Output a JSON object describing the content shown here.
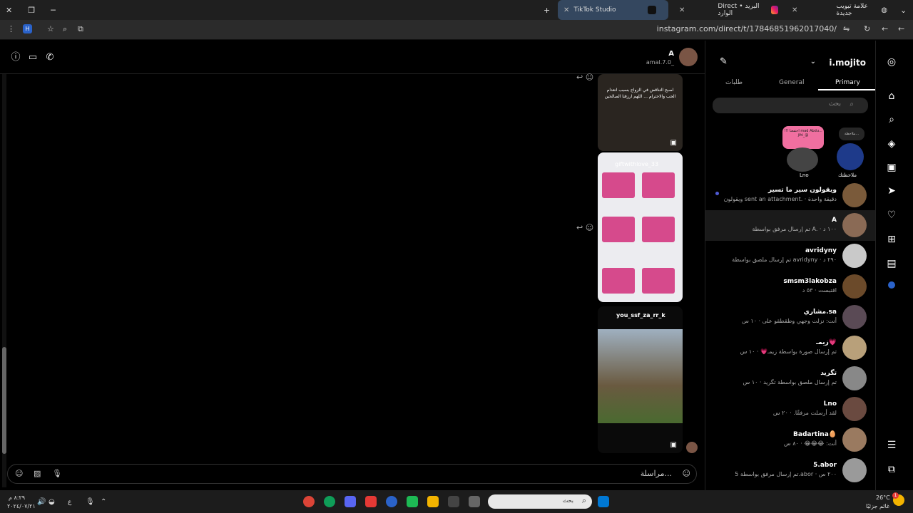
{
  "browser": {
    "tabs": [
      {
        "title": "TikTok Studio",
        "active": true
      },
      {
        "title": "Direct • البريد الوارد",
        "active": false
      },
      {
        "title": "علامة تبويب جديدة",
        "active": false
      }
    ],
    "url": "instagram.com/direct/t/17846851962017040/",
    "profile_letter": "H"
  },
  "chat": {
    "contact_name": "A",
    "contact_handle": "amal.7.0_",
    "media": [
      {
        "caption": "اصبح التناقض في الزواج بسبب انعدام الحب والاحترام ... اللهم ارزقنا الصالحين",
        "type": "reel"
      },
      {
        "sender": "giftwithlove_33",
        "type": "reel"
      },
      {
        "sender": "you_ssf_za_rr_k",
        "type": "reel"
      }
    ],
    "composer_placeholder": "مراسلة..."
  },
  "sidebar": {
    "username": "i.mojito",
    "tabs": [
      "Primary",
      "General",
      "طلبات"
    ],
    "active_tab": "Primary",
    "search_placeholder": "بحث",
    "notes": [
      {
        "label": "ملاحظتك",
        "bubble": "ملاحظة..."
      },
      {
        "label": "Lno",
        "bubble": "!!! احتفعنا mad Abdu... jihi_@"
      }
    ],
    "threads": [
      {
        "name": "ويقولون سير ما تسير",
        "msg": "ويقولون sent an attachment. · دقيقة واحدة",
        "color": "#7a5a3a"
      },
      {
        "name": "A",
        "msg": "تم إرسال مرفق بواسطة A. · ١٠٠ د",
        "color": "#8a6a55"
      },
      {
        "name": "avridyny",
        "msg": "تم إرسال ملصق بواسطة avridyny · ٢٩٠ د",
        "color": "#c9c9c9"
      },
      {
        "name": "smsm3lakobza",
        "msg": "اقتبست · ٥٣ د",
        "color": "#6b4a2a"
      },
      {
        "name": "مشاري.sa",
        "msg": "أنت: نزلت وجهي وطقطقو على · ١٠ س",
        "color": "#5a4a55"
      },
      {
        "name": "زيمـ💗",
        "msg": "تم إرسال صورة بواسطة زيمـ💗 · ١٠ س",
        "color": "#b8a07a"
      },
      {
        "name": "تگريد",
        "msg": "تم إرسال ملصق بواسطة تگريد · ١٠ س",
        "color": "#888888"
      },
      {
        "name": "Lno",
        "msg": "لقد أرسلت مرفقًا. · ٢٠ س",
        "color": "#6a4a40"
      },
      {
        "name": "Badartina🥚",
        "msg": "أنت: 😂😂😂 · ٨٠ س",
        "color": "#9a7a60"
      },
      {
        "name": "5.abor",
        "msg": "تم إرسال مرفق بواسطة 5.abor · ٢٠٠ س",
        "color": "#9a9a9a"
      }
    ]
  },
  "taskbar": {
    "weather_temp": "26°C",
    "weather_desc": "غائم جزئيًا",
    "search_placeholder": "بحث",
    "time": "٨:٢٩ م",
    "date": "٢٠٢٤/٠٧/٢١",
    "lang": "ع",
    "notif_count": "1"
  }
}
